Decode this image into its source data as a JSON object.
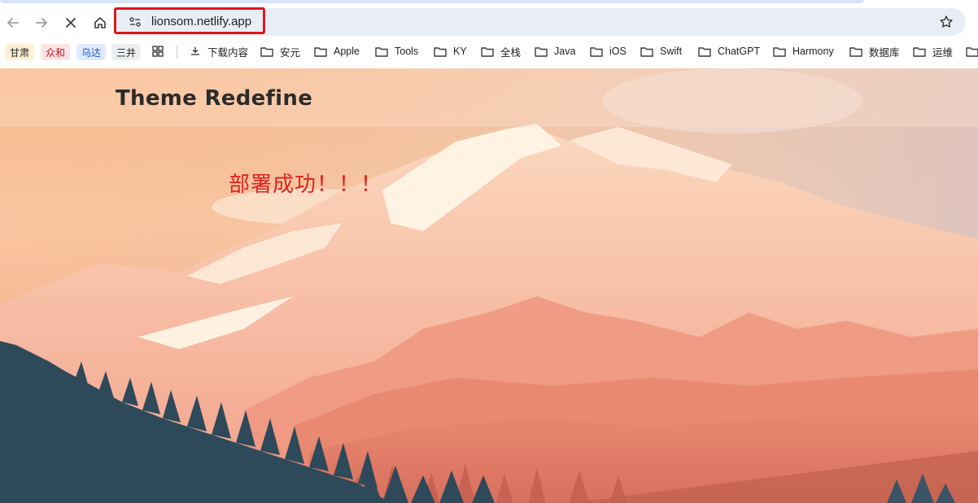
{
  "browser": {
    "url": "lionsom.netlify.app",
    "bookmarks_pills": [
      {
        "label": "甘肃",
        "bg": "#fdf0d5",
        "color": "#1f1f1f"
      },
      {
        "label": "众和",
        "bg": "#fce4e6",
        "color": "#c4131f"
      },
      {
        "label": "乌达",
        "bg": "#dfeafc",
        "color": "#1a56c8"
      },
      {
        "label": "三井",
        "bg": "#eceff1",
        "color": "#1f1f1f"
      }
    ],
    "bookmarks": [
      {
        "label": "下载内容",
        "icon": "download-icon"
      },
      {
        "label": "安元",
        "icon": "folder-icon"
      },
      {
        "label": "Apple",
        "icon": "folder-icon"
      },
      {
        "label": "Tools",
        "icon": "folder-icon"
      },
      {
        "label": "KY",
        "icon": "folder-icon"
      },
      {
        "label": "全栈",
        "icon": "folder-icon"
      },
      {
        "label": "Java",
        "icon": "folder-icon"
      },
      {
        "label": "iOS",
        "icon": "folder-icon"
      },
      {
        "label": "Swift",
        "icon": "folder-icon"
      },
      {
        "label": "ChatGPT",
        "icon": "folder-icon"
      },
      {
        "label": "Harmony",
        "icon": "folder-icon"
      },
      {
        "label": "数据库",
        "icon": "folder-icon"
      },
      {
        "label": "运维",
        "icon": "folder-icon"
      }
    ],
    "highlight_color": "#e0161e"
  },
  "site": {
    "title": "Theme Redefine",
    "message": "部署成功！！！",
    "message_color": "#e0201e"
  }
}
